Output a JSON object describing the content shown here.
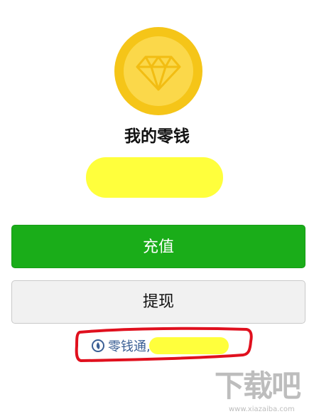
{
  "wallet": {
    "icon": "diamond-icon",
    "title": "我的零钱",
    "recharge_label": "充值",
    "withdraw_label": "提现"
  },
  "fund": {
    "icon": "licaitong-icon",
    "label": "零钱通,"
  },
  "colors": {
    "primary_green": "#1aad19",
    "coin_outer": "#f5c518",
    "coin_inner": "#fbd84a",
    "link_blue": "#3b5f95",
    "redaction_yellow": "#ffff3c",
    "annotation_red": "#e0101e"
  },
  "watermark": {
    "logo": "下载吧",
    "url": "www.xiazaiba.com"
  }
}
